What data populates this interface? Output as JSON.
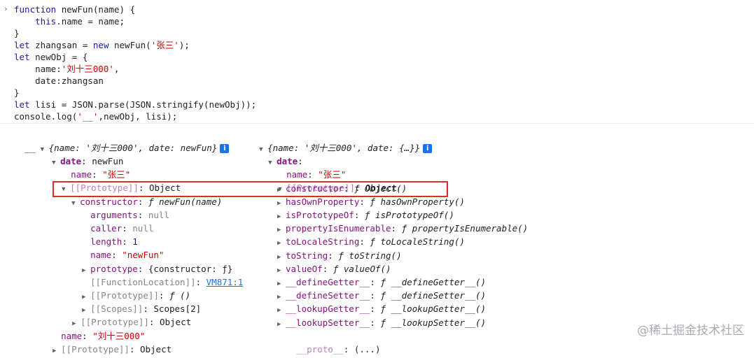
{
  "prompt_caret": "›",
  "code_lines": [
    "function newFun(name) {",
    "    this.name = name;",
    "}",
    "let zhangsan = new newFun('张三');",
    "let newObj = {",
    "    name:'刘十三000',",
    "    date:zhangsan",
    "}",
    "let lisi = JSON.parse(JSON.stringify(newObj));",
    "console.log('__',newObj, lisi);"
  ],
  "left": {
    "log_prefix": "__",
    "summary": "{name: '刘十三000', date: newFun}",
    "date_key": "date",
    "date_type": "newFun",
    "name_key": "name",
    "name_val": "\"张三\"",
    "proto_key": "[[Prototype]]",
    "proto_val": "Object",
    "ctor_key": "constructor",
    "ctor_f": "ƒ",
    "ctor_val": "newFun(name)",
    "arguments_key": "arguments",
    "arguments_val": "null",
    "caller_key": "caller",
    "caller_val": "null",
    "length_key": "length",
    "length_val": "1",
    "fname_key": "name",
    "fname_val": "\"newFun\"",
    "prototype_key": "prototype",
    "prototype_val": "{constructor: ƒ}",
    "loc_key": "[[FunctionLocation]]",
    "loc_val": "VM871:1",
    "fproto_key": "[[Prototype]]",
    "fproto_val": "ƒ ()",
    "scopes_key": "[[Scopes]]",
    "scopes_val": "Scopes[2]",
    "proto2_key": "[[Prototype]]",
    "proto2_val": "Object",
    "name2_key": "name",
    "name2_val": "\"刘十三000\"",
    "proto3_key": "[[Prototype]]",
    "proto3_val": "Object"
  },
  "right": {
    "summary": "{name: '刘十三000', date: {…}}",
    "date_key": "date",
    "name_key": "name",
    "name_val": "\"张三\"",
    "proto_key": "[[Prototype]]",
    "proto_val": "Object",
    "methods": [
      {
        "key": "constructor",
        "val": "Object()"
      },
      {
        "key": "hasOwnProperty",
        "val": "hasOwnProperty()"
      },
      {
        "key": "isPrototypeOf",
        "val": "isPrototypeOf()"
      },
      {
        "key": "propertyIsEnumerable",
        "val": "propertyIsEnumerable()"
      },
      {
        "key": "toLocaleString",
        "val": "toLocaleString()"
      },
      {
        "key": "toString",
        "val": "toString()"
      },
      {
        "key": "valueOf",
        "val": "valueOf()"
      },
      {
        "key": "__defineGetter__",
        "val": "__defineGetter__()"
      },
      {
        "key": "__defineSetter__",
        "val": "__defineSetter__()"
      },
      {
        "key": "__lookupGetter__",
        "val": "__lookupGetter__()"
      },
      {
        "key": "__lookupSetter__",
        "val": "__lookupSetter__()"
      }
    ],
    "f_glyph": "ƒ",
    "dunder_key": "__proto__",
    "dunder_val": "(...)"
  },
  "info_glyph": "i",
  "watermark": "@稀土掘金技术社区",
  "colors": {
    "highlight_border": "#d93025",
    "key": "#881280",
    "string": "#c80000",
    "link": "#1a73e8"
  }
}
